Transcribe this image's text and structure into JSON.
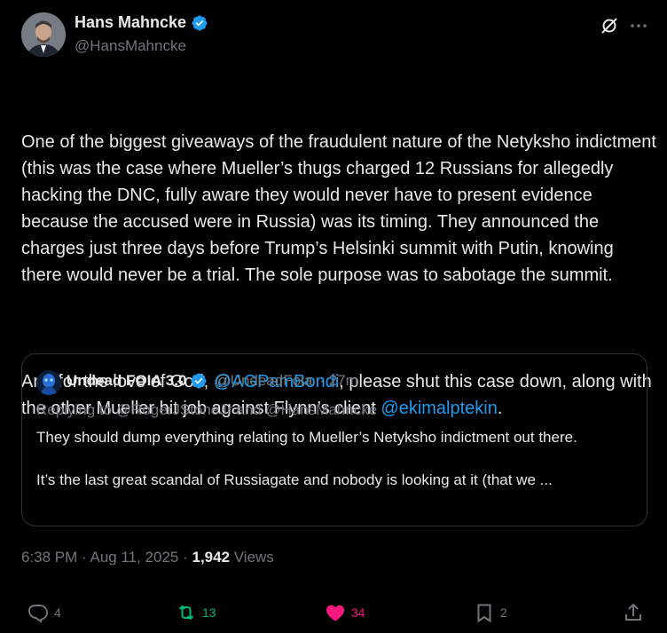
{
  "author": {
    "name": "Hans Mahncke",
    "handle": "@HansMahncke"
  },
  "post": {
    "paragraph1": "One of the biggest giveaways of the fraudulent nature of the Netyksho indictment (this was the case where Mueller’s thugs charged 12 Russians for allegedly hacking the DNC, fully aware they would never have to present evidence because the accused were in Russia) was its timing. They announced the charges just three days before Trump’s Helsinki summit with Putin, knowing there would never be a trial. The sole purpose was to sabotage the summit.",
    "p2_part1": "And for the love of God, ",
    "mention1": "@AGPamBondi",
    "p2_part2": ", please shut this case down, along with the other Mueller hit job against Flynn’s client ",
    "mention2": "@ekimalptekin",
    "p2_part3": "."
  },
  "quote": {
    "name": "Undead FOIA 3.0",
    "handle": "@UndeadFoia",
    "time": "· 27m",
    "replying_to": "Replying to @RogerJStoneJr and @HansMahncke",
    "line1": "They should dump everything relating to Mueller’s Netyksho indictment out there.",
    "line2": "It’s the last great scandal of Russiagate and nobody is looking at it (that we ..."
  },
  "meta": {
    "time": "6:38 PM · Aug 11, 2025 · ",
    "views_count": "1,942",
    "views_label": " Views"
  },
  "actions": {
    "replies": "4",
    "reposts": "13",
    "likes": "34",
    "bookmarks": "2"
  },
  "colors": {
    "background": "#000000",
    "text": "#e7e9ea",
    "muted": "#71767b",
    "link": "#1d9bf0",
    "verified": "#1d9bf0",
    "repost": "#00ba7c",
    "like": "#f91880",
    "border": "#2f3336"
  },
  "icons": [
    "verified-badge-icon",
    "grok-icon",
    "more-icon",
    "reply-icon",
    "repost-icon",
    "heart-icon",
    "bookmark-icon",
    "share-icon"
  ]
}
